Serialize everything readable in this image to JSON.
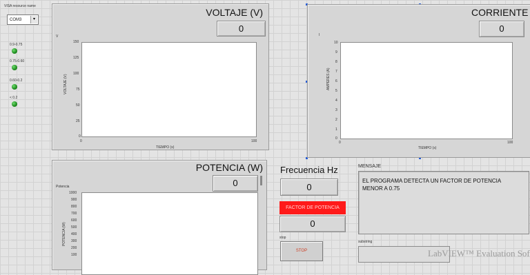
{
  "visa": {
    "label": "VISA resource name",
    "value": "COM3"
  },
  "leds": [
    {
      "label": "0.9-0.75"
    },
    {
      "label": "0.75-0.60"
    },
    {
      "label": "0.60-0.2"
    },
    {
      "label": "< 0.2"
    }
  ],
  "voltaje": {
    "title": "VOLTAJE (V)",
    "value": "0",
    "corner_label": "V",
    "ylabel": "VOLTAJE (V)",
    "xlabel": "TIEMPO (s)",
    "yticks": [
      "150",
      "125",
      "100",
      "75",
      "50",
      "25",
      "0"
    ],
    "xticks": [
      "0",
      "100"
    ]
  },
  "corriente": {
    "title": "CORRIENTE (A",
    "value": "0",
    "corner_label": "I",
    "ylabel": "AMPERES (A)",
    "xlabel": "TIEMPO (s)",
    "yticks": [
      "10",
      "9",
      "8",
      "7",
      "6",
      "5",
      "4",
      "3",
      "2",
      "1",
      "0"
    ],
    "xticks": [
      "0",
      "100"
    ]
  },
  "potencia": {
    "title": "POTENCIA (W)",
    "value": "0",
    "corner_label": "Potencia",
    "ylabel": "POTENCIA (W)",
    "yticks": [
      "1000",
      "900",
      "800",
      "700",
      "600",
      "500",
      "400",
      "300",
      "200",
      "100"
    ]
  },
  "frecuencia": {
    "label": "Frecuencia Hz",
    "value": "0"
  },
  "factor": {
    "label": "FACTOR DE POTENCIA",
    "value": "0",
    "color": "#ff1a1a"
  },
  "stop": {
    "label": "stop",
    "button": "STOP",
    "color": "#cc3b1f"
  },
  "mensaje": {
    "label": "MENSAJE",
    "text": "EL PROGRAMA DETECTA UN FACTOR DE POTENCIA MENOR A 0.75"
  },
  "substring": {
    "label": "substring"
  },
  "watermark": "LabVIEW™ Evaluation Software"
}
